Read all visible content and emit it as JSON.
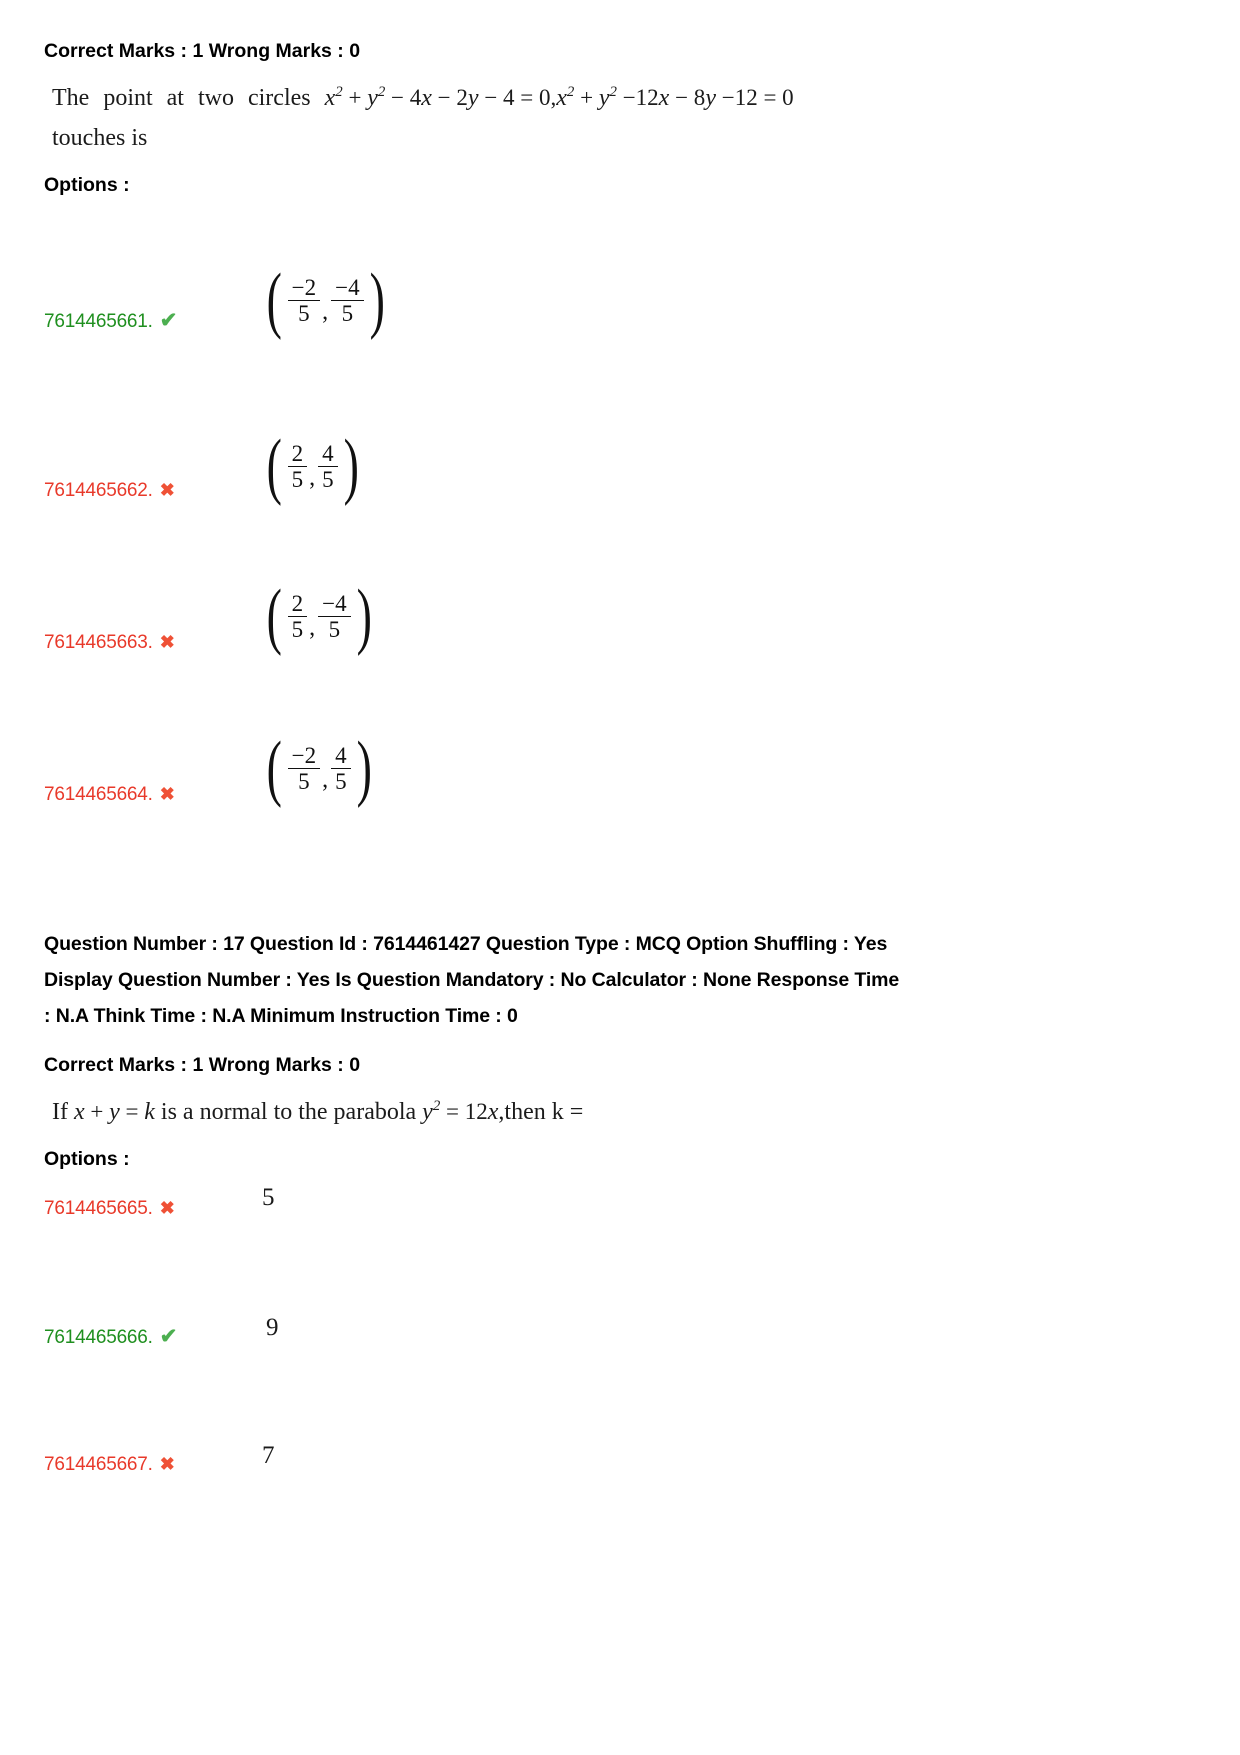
{
  "page": {
    "background": "#ffffff",
    "correct_color": "#1f8f1f",
    "wrong_color": "#e8392a",
    "tick_color": "#4caf50",
    "cross_color": "#ef5136"
  },
  "question_16": {
    "marks_line": "Correct Marks : 1 Wrong Marks : 0",
    "stem_words": [
      "The",
      "point",
      "at",
      "two",
      "circles"
    ],
    "stem_equation_1": "x² + y² − 4x − 2y − 4 = 0,",
    "stem_equation_2": "x² + y² −12x − 8y −12 = 0",
    "stem_tail": "touches is",
    "options_label": "Options :",
    "options": [
      {
        "id": "7614465661.",
        "state": "correct",
        "mark": "✔",
        "value_type": "pair",
        "x_num": "−2",
        "x_den": "5",
        "y_num": "−4",
        "y_den": "5"
      },
      {
        "id": "7614465662.",
        "state": "wrong",
        "mark": "✖",
        "value_type": "pair",
        "x_num": "2",
        "x_den": "5",
        "y_num": "4",
        "y_den": "5"
      },
      {
        "id": "7614465663.",
        "state": "wrong",
        "mark": "✖",
        "value_type": "pair",
        "x_num": "2",
        "x_den": "5",
        "y_num": "−4",
        "y_den": "5"
      },
      {
        "id": "7614465664.",
        "state": "wrong",
        "mark": "✖",
        "value_type": "pair",
        "x_num": "−2",
        "x_den": "5",
        "y_num": "4",
        "y_den": "5"
      }
    ]
  },
  "question_17": {
    "meta_line_1": "Question Number : 17 Question Id : 7614461427 Question Type : MCQ Option Shuffling : Yes",
    "meta_line_2": "Display Question Number : Yes Is Question Mandatory : No Calculator : None Response Time",
    "meta_line_3": ": N.A Think Time : N.A Minimum Instruction Time : 0",
    "marks_line": "Correct Marks : 1 Wrong Marks : 0",
    "stem_prefix": "If",
    "stem_eq_1": "x + y = k",
    "stem_middle": "is a normal to the parabola",
    "stem_eq_2": "y² = 12x",
    "stem_suffix": ",then k =",
    "options_label": "Options :",
    "options": [
      {
        "id": "7614465665.",
        "state": "wrong",
        "mark": "✖",
        "value_type": "plain",
        "value": "5"
      },
      {
        "id": "7614465666.",
        "state": "correct",
        "mark": "✔",
        "value_type": "plain",
        "value": "9"
      },
      {
        "id": "7614465667.",
        "state": "wrong",
        "mark": "✖",
        "value_type": "plain",
        "value": "7"
      }
    ]
  }
}
